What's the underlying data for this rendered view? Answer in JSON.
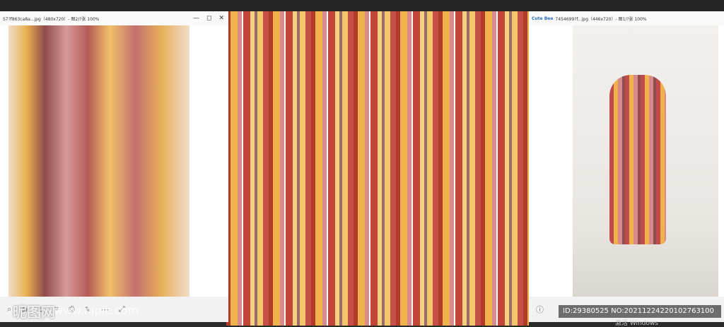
{
  "left_window": {
    "title": "S7?f863ca8a...jpg（480x720）- 图2/?张 100%",
    "controls": [
      "—",
      "◻",
      "✕"
    ]
  },
  "right_window": {
    "title": "7454699?f...jpg（446x720）- 图1/?张 100%",
    "app_badge": "Cute Bee",
    "controls": [
      "—",
      "◻",
      "✕"
    ]
  },
  "left_toolbar": {
    "icons": [
      "search-icon",
      "zoom-in-icon",
      "rotate-icon",
      "crop-icon",
      "print-icon",
      "edit-icon",
      "more-icon",
      "fullscreen-icon"
    ]
  },
  "right_toolbar": {
    "icons": [
      "info-icon"
    ]
  },
  "watermark": {
    "text": "ID:29380525 NO:20211224220102763100"
  },
  "nipic": {
    "logo": "昵图网",
    "url": "www.nipic.com"
  },
  "activate_text": "激活 Windows"
}
